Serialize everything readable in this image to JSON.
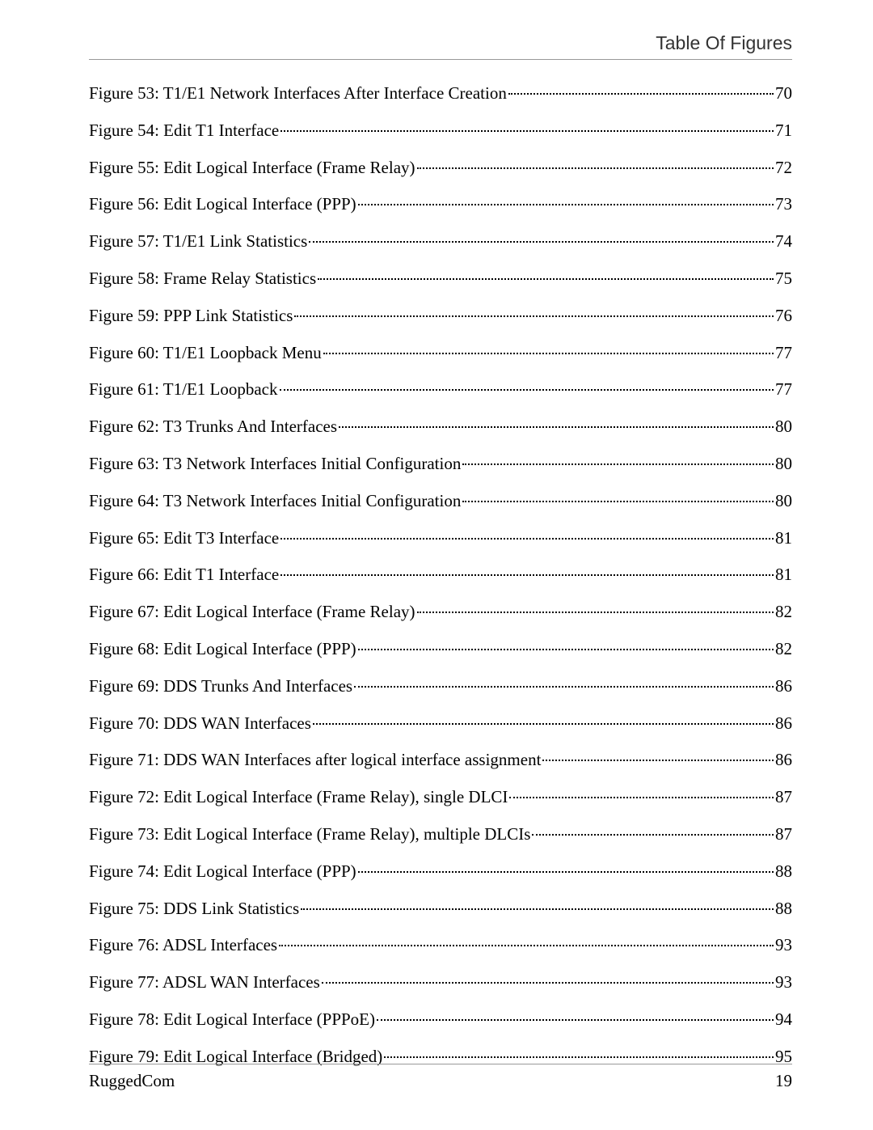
{
  "header": {
    "title": "Table Of Figures"
  },
  "toc": {
    "entries": [
      {
        "label": "Figure 53: T1/E1 Network Interfaces After Interface Creation",
        "page": "70"
      },
      {
        "label": "Figure 54: Edit T1 Interface",
        "page": "71"
      },
      {
        "label": "Figure 55: Edit Logical Interface (Frame Relay)",
        "page": "72"
      },
      {
        "label": "Figure 56: Edit Logical Interface (PPP)",
        "page": "73"
      },
      {
        "label": "Figure 57: T1/E1 Link Statistics",
        "page": "74"
      },
      {
        "label": "Figure 58: Frame Relay Statistics",
        "page": "75"
      },
      {
        "label": "Figure 59: PPP Link Statistics",
        "page": "76"
      },
      {
        "label": "Figure 60: T1/E1 Loopback Menu",
        "page": "77"
      },
      {
        "label": "Figure 61: T1/E1 Loopback",
        "page": "77"
      },
      {
        "label": "Figure 62: T3 Trunks And Interfaces",
        "page": "80"
      },
      {
        "label": "Figure 63: T3 Network Interfaces Initial Configuration",
        "page": "80"
      },
      {
        "label": "Figure 64: T3 Network Interfaces Initial Configuration",
        "page": "80"
      },
      {
        "label": "Figure 65: Edit T3 Interface",
        "page": "81"
      },
      {
        "label": "Figure 66: Edit T1 Interface",
        "page": "81"
      },
      {
        "label": "Figure 67: Edit Logical Interface (Frame Relay)",
        "page": "82"
      },
      {
        "label": "Figure 68: Edit Logical Interface (PPP)",
        "page": "82"
      },
      {
        "label": "Figure 69: DDS Trunks And Interfaces",
        "page": "86"
      },
      {
        "label": "Figure 70: DDS WAN Interfaces",
        "page": "86"
      },
      {
        "label": "Figure 71: DDS WAN Interfaces after logical interface assignment",
        "page": "86"
      },
      {
        "label": "Figure 72: Edit Logical Interface (Frame Relay), single DLCI",
        "page": "87"
      },
      {
        "label": "Figure 73: Edit Logical Interface (Frame Relay), multiple DLCIs",
        "page": "87"
      },
      {
        "label": "Figure 74: Edit Logical Interface (PPP)",
        "page": "88"
      },
      {
        "label": "Figure 75: DDS Link Statistics",
        "page": "88"
      },
      {
        "label": "Figure 76: ADSL Interfaces",
        "page": "93"
      },
      {
        "label": "Figure 77: ADSL WAN Interfaces",
        "page": "93"
      },
      {
        "label": "Figure 78: Edit Logical Interface (PPPoE)",
        "page": "94"
      },
      {
        "label": "Figure 79: Edit Logical Interface (Bridged)",
        "page": "95"
      }
    ]
  },
  "footer": {
    "company": "RuggedCom",
    "page_number": "19"
  }
}
